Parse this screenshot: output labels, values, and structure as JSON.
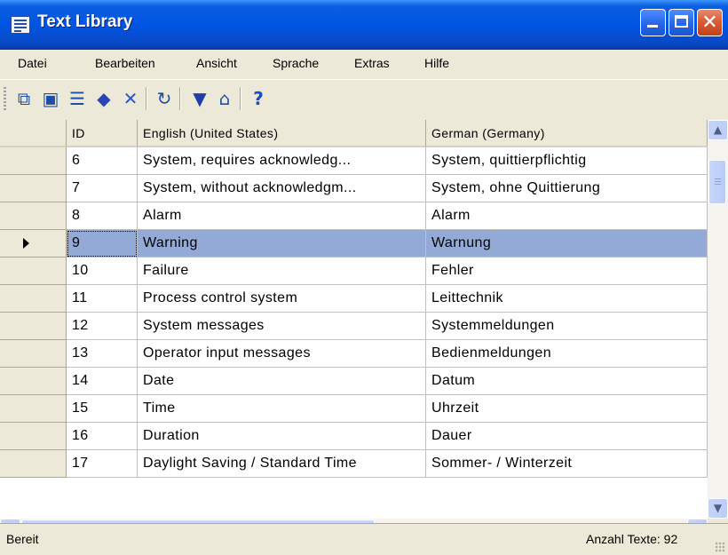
{
  "window": {
    "title": "Text Library"
  },
  "menu": [
    "Datei",
    "Bearbeiten",
    "Ansicht",
    "Sprache",
    "Extras",
    "Hilfe"
  ],
  "toolbar": [
    "copy-icon",
    "paste-icon",
    "properties-icon",
    "eraser-icon",
    "delete-icon",
    "refresh-icon",
    "filter-icon",
    "export-icon",
    "help-icon"
  ],
  "grid": {
    "columns": [
      "ID",
      "English (United States)",
      "German (Germany)"
    ],
    "rows": [
      {
        "id": "6",
        "en": "System, requires acknowledg...",
        "de": "System, quittierpflichtig"
      },
      {
        "id": "7",
        "en": "System, without acknowledgm...",
        "de": "System, ohne Quittierung"
      },
      {
        "id": "8",
        "en": "Alarm",
        "de": "Alarm"
      },
      {
        "id": "9",
        "en": "Warning",
        "de": "Warnung",
        "selected": true
      },
      {
        "id": "10",
        "en": "Failure",
        "de": "Fehler"
      },
      {
        "id": "11",
        "en": "Process control system",
        "de": "Leittechnik"
      },
      {
        "id": "12",
        "en": "System messages",
        "de": "Systemmeldungen"
      },
      {
        "id": "13",
        "en": "Operator input messages",
        "de": "Bedienmeldungen"
      },
      {
        "id": "14",
        "en": "Date",
        "de": "Datum"
      },
      {
        "id": "15",
        "en": "Time",
        "de": "Uhrzeit"
      },
      {
        "id": "16",
        "en": "Duration",
        "de": "Dauer"
      },
      {
        "id": "17",
        "en": "Daylight Saving / Standard Time",
        "de": "Sommer- / Winterzeit"
      }
    ]
  },
  "status": {
    "left": "Bereit",
    "right": "Anzahl Texte: 92"
  },
  "colors": {
    "titlebar": "#0054e3",
    "selection": "#93a9d6",
    "chrome": "#ece9d8"
  }
}
